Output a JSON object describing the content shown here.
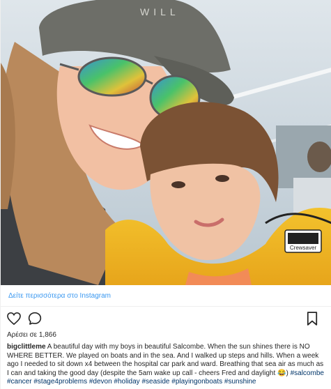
{
  "photo": {
    "alt_icons": [
      "sunglasses",
      "cap",
      "life-jacket"
    ],
    "jacket_brand": "Crewsaver"
  },
  "link": {
    "view_more": "Δείτε περισσότερα στο Instagram"
  },
  "likes": {
    "text": "Αρέσει σε 1,866"
  },
  "caption": {
    "username": "bigclittleme",
    "text": " A beautiful day with my boys in beautiful Salcombe. When the sun shines there is NO WHERE BETTER. We played on boats and in the sea. And I walked up steps and hills. When a week ago I needed to sit down x4 between the hospital car park and ward. Breathing that sea air as much as I can and taking the good day (despite the 5am wake up call - cheers Fred and daylight 😂) ",
    "hashtags": "#salcombe #cancer #stage4problems #devon #holiday #seaside #playingonboats #sunshine"
  },
  "icons": {
    "like": "heart-icon",
    "comment": "comment-icon",
    "save": "bookmark-icon"
  },
  "colors": {
    "link": "#3897f0",
    "hashtag": "#003569",
    "text": "#262626"
  }
}
